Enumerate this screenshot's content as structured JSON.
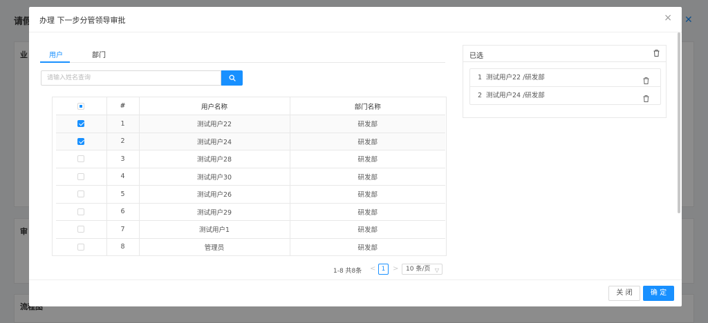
{
  "background": {
    "page_title": "请假",
    "section1_label": "业",
    "section2_label": "审",
    "section3_label": "流程图"
  },
  "modal": {
    "title": "办理 下一步分管领导审批",
    "close_icon": "×"
  },
  "tabs": [
    {
      "label": "用户",
      "active": true
    },
    {
      "label": "部门",
      "active": false
    }
  ],
  "search": {
    "placeholder": "请输入姓名查询",
    "value": ""
  },
  "table": {
    "columns": [
      "#",
      "用户名称",
      "部门名称"
    ],
    "rows": [
      {
        "index": "1",
        "name": "测试用户22",
        "dept": "研发部",
        "checked": true
      },
      {
        "index": "2",
        "name": "测试用户24",
        "dept": "研发部",
        "checked": true
      },
      {
        "index": "3",
        "name": "测试用户28",
        "dept": "研发部",
        "checked": false
      },
      {
        "index": "4",
        "name": "测试用户30",
        "dept": "研发部",
        "checked": false
      },
      {
        "index": "5",
        "name": "测试用户26",
        "dept": "研发部",
        "checked": false
      },
      {
        "index": "6",
        "name": "测试用户29",
        "dept": "研发部",
        "checked": false
      },
      {
        "index": "7",
        "name": "测试用户1",
        "dept": "研发部",
        "checked": false
      },
      {
        "index": "8",
        "name": "管理员",
        "dept": "研发部",
        "checked": false
      }
    ]
  },
  "pagination": {
    "total_text": "1-8 共8条",
    "prev": "<",
    "current_page": "1",
    "next": ">",
    "page_size": "10 条/页"
  },
  "selected": {
    "title": "已选",
    "items": [
      {
        "index": "1",
        "label": "测试用户22 /研发部"
      },
      {
        "index": "2",
        "label": "测试用户24 /研发部"
      }
    ]
  },
  "footer": {
    "close_label": "关 闭",
    "ok_label": "确 定"
  },
  "colors": {
    "primary": "#1890ff",
    "border": "#e8e8e8"
  }
}
